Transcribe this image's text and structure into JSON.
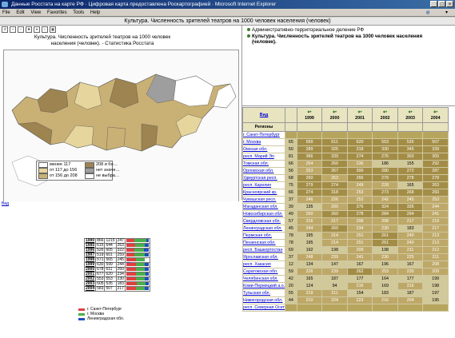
{
  "window": {
    "title": "Данные Росстата на карте РФ · Цифровая карта предоставлена Роскартографией · Microsoft Internet Explorer",
    "buttons": [
      "_",
      "□",
      "×"
    ]
  },
  "menubar": {
    "items": [
      "File",
      "Edit",
      "View",
      "Favorites",
      "Tools",
      "Help"
    ]
  },
  "page_title": "Культура. Численность зрителей театров на 1000 человек населения (человек)",
  "map": {
    "caption_line1": "Культура. Численность зрителей театров на 1000 человек",
    "caption_line2": "населения (человек). - Статистика Росстата",
    "legend": [
      {
        "label": "менее 117",
        "color": "#ffffff"
      },
      {
        "label": "от 117 до 156",
        "color": "#e6d59c"
      },
      {
        "label": "от 156 до 208",
        "color": "#c9b075"
      },
      {
        "label": "208 и бо…",
        "color": "#9d8450"
      },
      {
        "label": "нет значе…",
        "color": "#9e9e9e"
      },
      {
        "label": "не выбра…",
        "color": "#ffffff"
      }
    ]
  },
  "tree": {
    "items": [
      "Административно-территориальное деление РФ",
      "Культура. Численность зрителей театров на 1000 человек населения",
      "(человек)."
    ]
  },
  "left_bottom": {
    "link": "Вид",
    "legend": [
      "г. Санкт-Петербург",
      "г. Москва",
      "Ленинградская обл."
    ],
    "legend_colors": [
      "#e04040",
      "#48b048",
      "#1e4fbf"
    ],
    "rows": [
      {
        "year": "1990",
        "v1": "866",
        "v2": "1215",
        "v3": "247"
      },
      {
        "year": "1995",
        "v1": "615",
        "v2": "644",
        "v3": "263"
      },
      {
        "year": "1996",
        "v1": "526",
        "v2": "605",
        "v3": "322"
      },
      {
        "year": "1997",
        "v1": "519",
        "v2": "601",
        "v3": "259"
      },
      {
        "year": "1998",
        "v1": "571",
        "v2": "565",
        "v3": "245"
      },
      {
        "year": "1999",
        "v1": "630",
        "v2": "599",
        "v3": "244"
      },
      {
        "year": "2000",
        "v1": "678",
        "v2": "611",
        "v3": "260"
      },
      {
        "year": "2001",
        "v1": "677",
        "v2": "620",
        "v3": "234"
      },
      {
        "year": "2002",
        "v1": "553",
        "v2": "553",
        "v3": "230"
      },
      {
        "year": "2003",
        "v1": "605",
        "v2": "535",
        "v3": "183"
      },
      {
        "year": "2004",
        "v1": "583",
        "v2": "507",
        "v3": "217"
      }
    ]
  },
  "table": {
    "view_link": "Вид",
    "header_label": "Регионы",
    "years": [
      "1999",
      "2000",
      "2001",
      "2002",
      "2003",
      "2004"
    ],
    "rows": [
      {
        "name": "г. Санкт-Петербург",
        "vals": [
          "",
          "",
          "",
          "",
          "",
          ""
        ]
      },
      {
        "name": "г. Москва",
        "vals": [
          "65",
          "599",
          "611",
          "620",
          "553",
          "535",
          "507"
        ]
      },
      {
        "name": "Омская обл.",
        "vals": [
          "50",
          "289",
          "325",
          "318",
          "330",
          "345",
          "339"
        ]
      },
      {
        "name": "респ. Марий Эл",
        "vals": [
          "81",
          "366",
          "339",
          "274",
          "276",
          "303",
          "305"
        ]
      },
      {
        "name": "Томская обл.",
        "vals": [
          "66",
          "254",
          "260",
          "236",
          "186",
          "155",
          "292"
        ]
      },
      {
        "name": "Орловская обл.",
        "vals": [
          "56",
          "253",
          "267",
          "300",
          "280",
          "272",
          "287"
        ]
      },
      {
        "name": "Удмуртская респ.",
        "vals": [
          "68",
          "260",
          "253",
          "266",
          "279",
          "278",
          "278"
        ]
      },
      {
        "name": "респ. Карелия",
        "vals": [
          "75",
          "279",
          "274",
          "249",
          "228",
          "165",
          "263"
        ]
      },
      {
        "name": "Красноярский кр.",
        "vals": [
          "66",
          "274",
          "318",
          "253",
          "273",
          "268",
          "260"
        ]
      },
      {
        "name": "Чувашская респ.",
        "vals": [
          "37",
          "246",
          "226",
          "253",
          "242",
          "245",
          "253"
        ]
      },
      {
        "name": "Магаданская обл.",
        "vals": [
          "39",
          "135",
          "200",
          "376",
          "324",
          "336",
          "244"
        ]
      },
      {
        "name": "Новосибирская обл.",
        "vals": [
          "49",
          "250",
          "260",
          "278",
          "284",
          "294",
          "241"
        ]
      },
      {
        "name": "Свердловская обл.",
        "vals": [
          "57",
          "216",
          "217",
          "208",
          "208",
          "217",
          "219"
        ]
      },
      {
        "name": "Ленинградская обл.",
        "vals": [
          "45",
          "244",
          "260",
          "234",
          "230",
          "183",
          "217"
        ]
      },
      {
        "name": "Пермская обл.",
        "vals": [
          "78",
          "195",
          "214",
          "251",
          "261",
          "240",
          "213"
        ]
      },
      {
        "name": "Пензенская обл.",
        "vals": [
          "78",
          "195",
          "214",
          "251",
          "261",
          "240",
          "213"
        ]
      },
      {
        "name": "респ. Башкортостан",
        "vals": [
          "69",
          "192",
          "198",
          "209",
          "198",
          "211",
          "212"
        ]
      },
      {
        "name": "Ярославская обл.",
        "vals": [
          "37",
          "248",
          "239",
          "241",
          "230",
          "225",
          "211"
        ]
      },
      {
        "name": "респ. Хакасия",
        "vals": [
          "12",
          "134",
          "147",
          "167",
          "196",
          "167",
          "208"
        ]
      },
      {
        "name": "Саратовская обл.",
        "vals": [
          "59",
          "226",
          "239",
          "262",
          "253",
          "230",
          "209"
        ]
      },
      {
        "name": "Челябинская обл.",
        "vals": [
          "42",
          "165",
          "187",
          "177",
          "164",
          "177",
          "199"
        ]
      },
      {
        "name": "Коми-Пермяцкий а.о.",
        "vals": [
          "20",
          "124",
          "94",
          "216",
          "169",
          "216",
          "198"
        ]
      },
      {
        "name": "Тульская обл.",
        "vals": [
          "55",
          "219",
          "211",
          "154",
          "183",
          "187",
          "197"
        ]
      },
      {
        "name": "Нижегородская обл.",
        "vals": [
          "44",
          "210",
          "224",
          "223",
          "216",
          "204",
          "195"
        ]
      },
      {
        "name": "респ. Северная Осетия",
        "vals": [
          "",
          "",
          "",
          "",
          "",
          "",
          ""
        ]
      }
    ]
  }
}
